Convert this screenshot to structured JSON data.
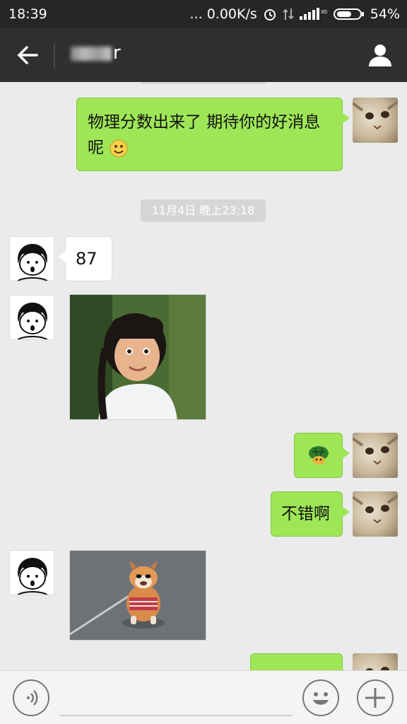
{
  "status_bar": {
    "time": "18:39",
    "network_speed": "... 0.00K/s",
    "battery": "54%"
  },
  "header": {
    "contact_name_visible": "r"
  },
  "messages": {
    "m1_text": "物理分数出来了 期待你的好消息呢",
    "timestamp": "11月4日 晚上23:18",
    "m2_text": "87",
    "m5_text": "不错啊"
  },
  "icons": {
    "back": "back-arrow-icon",
    "profile": "profile-icon",
    "voice": "voice-icon",
    "emoji": "emoji-icon",
    "add": "add-icon"
  },
  "colors": {
    "bubble_green": "#9ee656",
    "title_bar": "#2f2f2f",
    "status_bar": "#262626",
    "chat_bg": "#ebebeb"
  }
}
